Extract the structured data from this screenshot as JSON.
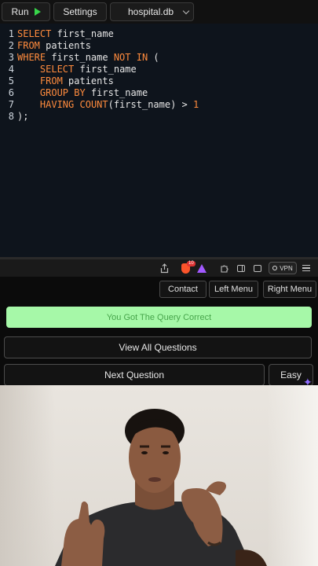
{
  "toolbar": {
    "run_label": "Run",
    "settings_label": "Settings",
    "database": "hospital.db"
  },
  "editor": {
    "lines": [
      {
        "n": "1",
        "tokens": [
          {
            "t": "SELECT",
            "k": "kw"
          },
          {
            "t": " first_name",
            "k": ""
          }
        ]
      },
      {
        "n": "2",
        "tokens": [
          {
            "t": "FROM",
            "k": "kw"
          },
          {
            "t": " patients",
            "k": ""
          }
        ]
      },
      {
        "n": "3",
        "tokens": [
          {
            "t": "WHERE",
            "k": "kw"
          },
          {
            "t": " first_name ",
            "k": ""
          },
          {
            "t": "NOT IN",
            "k": "kw"
          },
          {
            "t": " (",
            "k": ""
          }
        ]
      },
      {
        "n": "4",
        "tokens": [
          {
            "t": "    ",
            "k": ""
          },
          {
            "t": "SELECT",
            "k": "kw"
          },
          {
            "t": " first_name",
            "k": ""
          }
        ]
      },
      {
        "n": "5",
        "tokens": [
          {
            "t": "    ",
            "k": ""
          },
          {
            "t": "FROM",
            "k": "kw"
          },
          {
            "t": " patients",
            "k": ""
          }
        ]
      },
      {
        "n": "6",
        "tokens": [
          {
            "t": "    ",
            "k": ""
          },
          {
            "t": "GROUP BY",
            "k": "kw"
          },
          {
            "t": " first_name",
            "k": ""
          }
        ]
      },
      {
        "n": "7",
        "tokens": [
          {
            "t": "    ",
            "k": ""
          },
          {
            "t": "HAVING",
            "k": "kw"
          },
          {
            "t": " ",
            "k": ""
          },
          {
            "t": "COUNT",
            "k": "kw"
          },
          {
            "t": "(first_name) > ",
            "k": ""
          },
          {
            "t": "1",
            "k": "num"
          }
        ]
      },
      {
        "n": "8",
        "tokens": [
          {
            "t": ");",
            "k": ""
          }
        ]
      }
    ]
  },
  "browser": {
    "badge_count": "10",
    "vpn_label": "VPN"
  },
  "nav": {
    "contact": "Contact",
    "left_menu": "Left Menu",
    "right_menu": "Right Menu"
  },
  "result": {
    "message": "You Got The Query Correct"
  },
  "actions": {
    "view_all": "View All Questions",
    "next": "Next Question",
    "difficulty": "Easy"
  },
  "colors": {
    "keyword": "#ff8b3d",
    "success_bg": "#a6f8a8",
    "success_text": "#47a54b",
    "run_icon": "#38d64a"
  }
}
